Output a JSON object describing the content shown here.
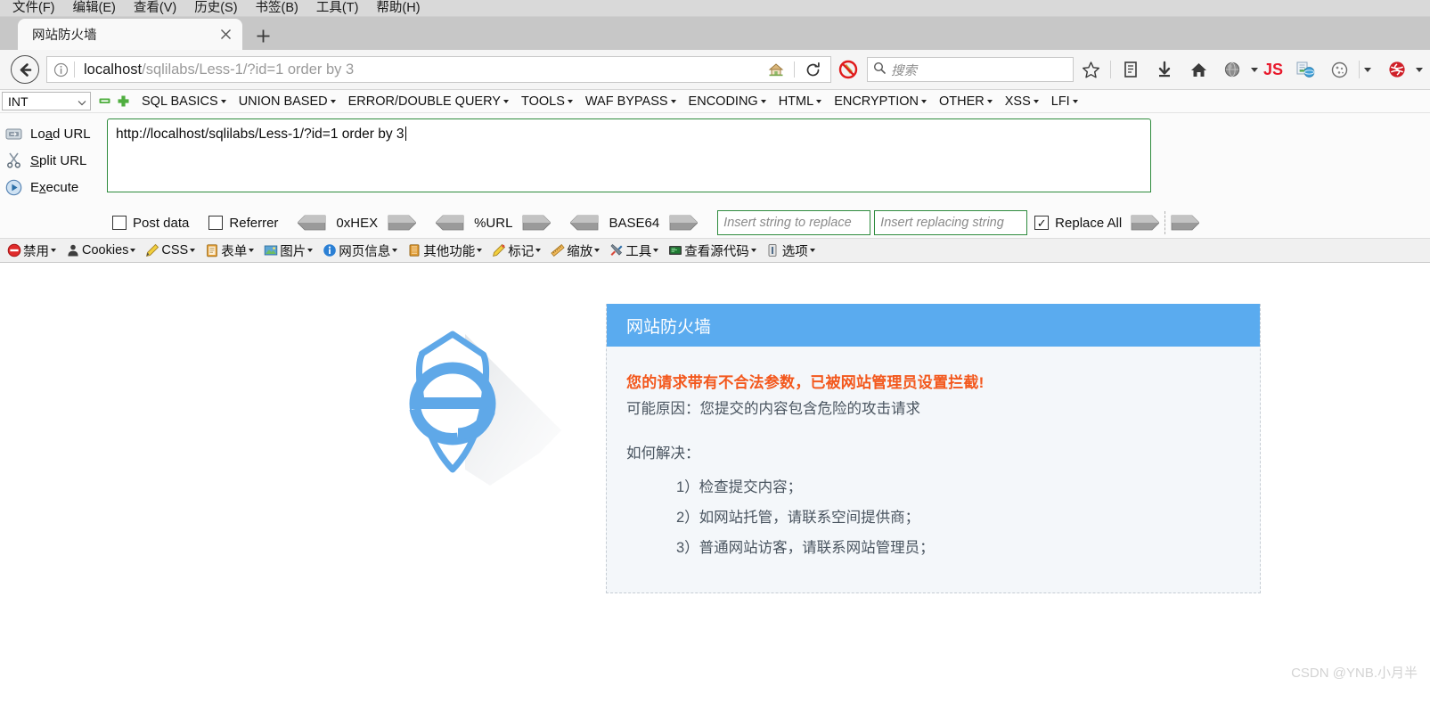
{
  "browser": {
    "menubar": [
      {
        "label": "文件(F)",
        "accel": "F"
      },
      {
        "label": "编辑(E)",
        "accel": "E"
      },
      {
        "label": "查看(V)",
        "accel": "V"
      },
      {
        "label": "历史(S)",
        "accel": "S"
      },
      {
        "label": "书签(B)",
        "accel": "B"
      },
      {
        "label": "工具(T)",
        "accel": "T"
      },
      {
        "label": "帮助(H)",
        "accel": "H"
      }
    ],
    "tab": {
      "title": "网站防火墙",
      "close_icon": "close-icon",
      "newtab_icon": "plus-icon"
    },
    "nav": {
      "back_icon": "back-arrow-icon",
      "info_icon": "info-circle-icon",
      "url_host": "localhost",
      "url_path": "/sqlilabs/Less-1/?id=1 order by 3",
      "home_icon": "home-house-icon",
      "reload_icon": "reload-icon",
      "noscript_icon": "noscript-blocked-icon",
      "search_placeholder": "搜索",
      "search_icon": "search-icon",
      "bookmark_icon": "star-icon",
      "library_icon": "library-icon",
      "downloads_icon": "download-arrow-icon",
      "home2_icon": "home-icon",
      "globe_icon": "globe-icon",
      "js_icon": "JS",
      "ieview_icon": "ie-view-icon",
      "cookie_icon": "cookie-icon",
      "overflow_icon": "chevron-down-icon",
      "adblock_icon": "adblock-icon"
    }
  },
  "hackbar": {
    "type_select": "INT",
    "remove_icon": "minus-square-icon",
    "add_icon": "plus-square-icon",
    "menus": [
      "SQL BASICS",
      "UNION BASED",
      "ERROR/DOUBLE QUERY",
      "TOOLS",
      "WAF BYPASS",
      "ENCODING",
      "HTML",
      "ENCRYPTION",
      "OTHER",
      "XSS",
      "LFI"
    ],
    "actions": [
      {
        "label": "Load URL",
        "accel": "a",
        "icon": "load-url-icon"
      },
      {
        "label": "Split URL",
        "accel": "S",
        "icon": "split-url-icon"
      },
      {
        "label": "Execute",
        "accel": "x",
        "icon": "execute-play-icon"
      }
    ],
    "url_value": "http://localhost/sqlilabs/Less-1/?id=1 order by 3",
    "options": {
      "post_data_label": "Post data",
      "post_data_checked": false,
      "referrer_label": "Referrer",
      "referrer_checked": false,
      "encoders": [
        "0xHEX",
        "%URL",
        "BASE64"
      ],
      "replace_from_placeholder": "Insert string to replace",
      "replace_to_placeholder": "Insert replacing string",
      "replace_all_label": "Replace All",
      "replace_all_checked": true
    }
  },
  "devtoolbar": [
    {
      "label": "禁用",
      "icon": "disable-icon"
    },
    {
      "label": "Cookies",
      "icon": "cookies-person-icon"
    },
    {
      "label": "CSS",
      "icon": "css-pencil-icon"
    },
    {
      "label": "表单",
      "icon": "forms-clipboard-icon"
    },
    {
      "label": "图片",
      "icon": "images-picture-icon"
    },
    {
      "label": "网页信息",
      "icon": "page-info-icon"
    },
    {
      "label": "其他功能",
      "icon": "misc-icon"
    },
    {
      "label": "标记",
      "icon": "outline-pencil-icon"
    },
    {
      "label": "缩放",
      "icon": "resize-ruler-icon"
    },
    {
      "label": "工具",
      "icon": "tools-wrench-icon"
    },
    {
      "label": "查看源代码",
      "icon": "view-source-icon"
    },
    {
      "label": "选项",
      "icon": "options-icon"
    }
  ],
  "page": {
    "shield_logo_icon": "shield-e-logo-icon",
    "panel": {
      "title": "网站防火墙",
      "alert": "您的请求带有不合法参数，已被网站管理员设置拦截!",
      "reason": "可能原因：您提交的内容包含危险的攻击请求",
      "howto_label": "如何解决：",
      "steps": [
        "1）检查提交内容；",
        "2）如网站托管，请联系空间提供商；",
        "3）普通网站访客，请联系网站管理员；"
      ]
    },
    "watermark": "CSDN @YNB.小月半"
  },
  "colors": {
    "panel_header": "#5aabef",
    "panel_body": "#f4f7fa",
    "alert_text": "#f3581d",
    "body_text": "#4a5560",
    "logo_blue": "#5fa8e8",
    "hackbar_border": "#2e8b3d"
  }
}
